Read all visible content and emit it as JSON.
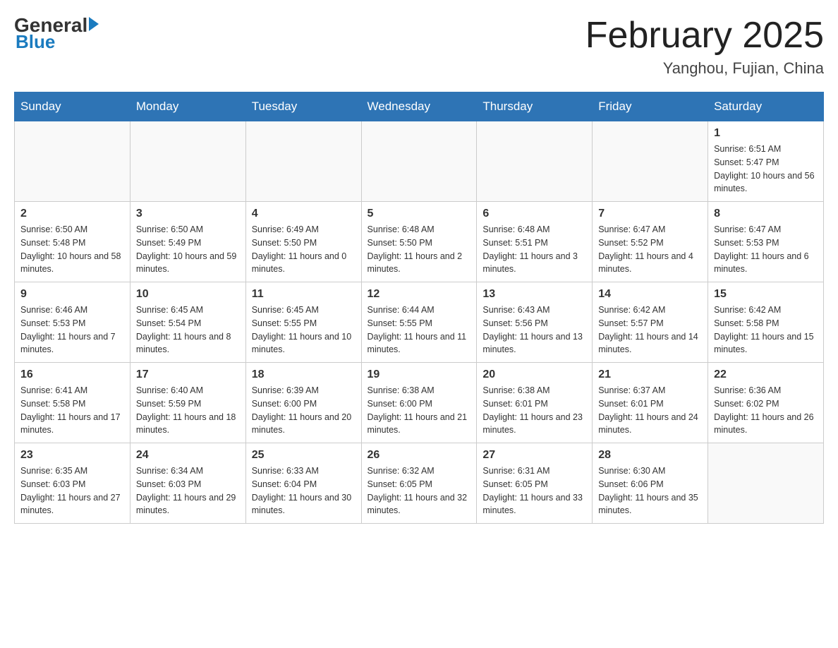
{
  "header": {
    "logo_general": "General",
    "logo_blue": "Blue",
    "month_title": "February 2025",
    "location": "Yanghou, Fujian, China"
  },
  "weekdays": [
    "Sunday",
    "Monday",
    "Tuesday",
    "Wednesday",
    "Thursday",
    "Friday",
    "Saturday"
  ],
  "weeks": [
    [
      {
        "day": "",
        "info": ""
      },
      {
        "day": "",
        "info": ""
      },
      {
        "day": "",
        "info": ""
      },
      {
        "day": "",
        "info": ""
      },
      {
        "day": "",
        "info": ""
      },
      {
        "day": "",
        "info": ""
      },
      {
        "day": "1",
        "info": "Sunrise: 6:51 AM\nSunset: 5:47 PM\nDaylight: 10 hours and 56 minutes."
      }
    ],
    [
      {
        "day": "2",
        "info": "Sunrise: 6:50 AM\nSunset: 5:48 PM\nDaylight: 10 hours and 58 minutes."
      },
      {
        "day": "3",
        "info": "Sunrise: 6:50 AM\nSunset: 5:49 PM\nDaylight: 10 hours and 59 minutes."
      },
      {
        "day": "4",
        "info": "Sunrise: 6:49 AM\nSunset: 5:50 PM\nDaylight: 11 hours and 0 minutes."
      },
      {
        "day": "5",
        "info": "Sunrise: 6:48 AM\nSunset: 5:50 PM\nDaylight: 11 hours and 2 minutes."
      },
      {
        "day": "6",
        "info": "Sunrise: 6:48 AM\nSunset: 5:51 PM\nDaylight: 11 hours and 3 minutes."
      },
      {
        "day": "7",
        "info": "Sunrise: 6:47 AM\nSunset: 5:52 PM\nDaylight: 11 hours and 4 minutes."
      },
      {
        "day": "8",
        "info": "Sunrise: 6:47 AM\nSunset: 5:53 PM\nDaylight: 11 hours and 6 minutes."
      }
    ],
    [
      {
        "day": "9",
        "info": "Sunrise: 6:46 AM\nSunset: 5:53 PM\nDaylight: 11 hours and 7 minutes."
      },
      {
        "day": "10",
        "info": "Sunrise: 6:45 AM\nSunset: 5:54 PM\nDaylight: 11 hours and 8 minutes."
      },
      {
        "day": "11",
        "info": "Sunrise: 6:45 AM\nSunset: 5:55 PM\nDaylight: 11 hours and 10 minutes."
      },
      {
        "day": "12",
        "info": "Sunrise: 6:44 AM\nSunset: 5:55 PM\nDaylight: 11 hours and 11 minutes."
      },
      {
        "day": "13",
        "info": "Sunrise: 6:43 AM\nSunset: 5:56 PM\nDaylight: 11 hours and 13 minutes."
      },
      {
        "day": "14",
        "info": "Sunrise: 6:42 AM\nSunset: 5:57 PM\nDaylight: 11 hours and 14 minutes."
      },
      {
        "day": "15",
        "info": "Sunrise: 6:42 AM\nSunset: 5:58 PM\nDaylight: 11 hours and 15 minutes."
      }
    ],
    [
      {
        "day": "16",
        "info": "Sunrise: 6:41 AM\nSunset: 5:58 PM\nDaylight: 11 hours and 17 minutes."
      },
      {
        "day": "17",
        "info": "Sunrise: 6:40 AM\nSunset: 5:59 PM\nDaylight: 11 hours and 18 minutes."
      },
      {
        "day": "18",
        "info": "Sunrise: 6:39 AM\nSunset: 6:00 PM\nDaylight: 11 hours and 20 minutes."
      },
      {
        "day": "19",
        "info": "Sunrise: 6:38 AM\nSunset: 6:00 PM\nDaylight: 11 hours and 21 minutes."
      },
      {
        "day": "20",
        "info": "Sunrise: 6:38 AM\nSunset: 6:01 PM\nDaylight: 11 hours and 23 minutes."
      },
      {
        "day": "21",
        "info": "Sunrise: 6:37 AM\nSunset: 6:01 PM\nDaylight: 11 hours and 24 minutes."
      },
      {
        "day": "22",
        "info": "Sunrise: 6:36 AM\nSunset: 6:02 PM\nDaylight: 11 hours and 26 minutes."
      }
    ],
    [
      {
        "day": "23",
        "info": "Sunrise: 6:35 AM\nSunset: 6:03 PM\nDaylight: 11 hours and 27 minutes."
      },
      {
        "day": "24",
        "info": "Sunrise: 6:34 AM\nSunset: 6:03 PM\nDaylight: 11 hours and 29 minutes."
      },
      {
        "day": "25",
        "info": "Sunrise: 6:33 AM\nSunset: 6:04 PM\nDaylight: 11 hours and 30 minutes."
      },
      {
        "day": "26",
        "info": "Sunrise: 6:32 AM\nSunset: 6:05 PM\nDaylight: 11 hours and 32 minutes."
      },
      {
        "day": "27",
        "info": "Sunrise: 6:31 AM\nSunset: 6:05 PM\nDaylight: 11 hours and 33 minutes."
      },
      {
        "day": "28",
        "info": "Sunrise: 6:30 AM\nSunset: 6:06 PM\nDaylight: 11 hours and 35 minutes."
      },
      {
        "day": "",
        "info": ""
      }
    ]
  ]
}
